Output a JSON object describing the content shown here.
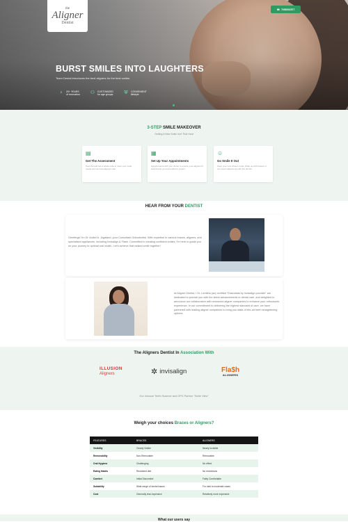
{
  "header": {
    "logo": {
      "the": "the",
      "main": "Aligner",
      "sub": "Dentist"
    },
    "call_button": "7058032577"
  },
  "hero": {
    "title": "BURST SMILES INTO LAUGHTERS",
    "subtitle": "Team Dental introduces the best aligners for the best smiles.",
    "stats": [
      {
        "icon": "lightbulb-icon",
        "line1": "20+ YEARS",
        "line2": "of innovation"
      },
      {
        "icon": "users-icon",
        "line1": "CUSTOMIZED",
        "line2": "for age groups"
      },
      {
        "icon": "shield-icon",
        "line1": "CONVENIENT",
        "line2": "lifestyle"
      }
    ]
  },
  "steps": {
    "title_accent": "3-STEP",
    "title_rest": " SMILE MAKEOVER",
    "subtitle": "Getting A New Smile Isn't That Hard",
    "cards": [
      {
        "icon": "clipboard-icon",
        "title": "Get The Assessment",
        "text": "Team Dental has a whole suite to meet your smile needs and we treat aligners well."
      },
      {
        "icon": "calendar-icon",
        "title": "Set Up Your Appointments",
        "text": "Appointments with your doctor to ensure your aligners fit well and let you know what to expect."
      },
      {
        "icon": "smile-icon",
        "title": "Go Smile It Out",
        "text": "Keep your new chosen smile. Wrap up with braces or our expert alignments with the dentist."
      }
    ]
  },
  "hear": {
    "title_plain": "HEAR FROM YOUR ",
    "title_accent": "DENTIST",
    "doctor1_text": "Greetings! I'm Dr. Anikel A. Jugaland, your Consultant Orthodontist. With expertise in various braces, aligners, and specialised appliances, including Invisalign & Flash. Committed to creating confident smiles, I'm here to guide you on your journey to optimal oral health. Let's achieve that radiant smile together!",
    "doctor2_text": "At Aligner Dentist, I Dr. Lemitha (an) certified \"Essentials by Invisalign provider\" am dedicated to provide you with the latest advancements in dental care, and delighted to announce our collaboration with renowned aligner companies to enhance your orthodontic experience. In our commitment to delivering the highest standard of care, we have partnered with leading aligner companies to bring you state-of-the-art teeth straightening options."
  },
  "association": {
    "title_plain": "The Aligners Dentist In ",
    "title_accent": "Association With",
    "brands": {
      "illusion_l1": "ILLUSION",
      "illusion_l2": "Aligners",
      "invisalign": "invisalign",
      "flash_l1": "Fla$h",
      "flash_l2": "ALIGNERS"
    },
    "note": "Our Inhouse Teeth Scanner and OPG Partner \"Smile View\""
  },
  "compare": {
    "title_plain": "Weigh your choices ",
    "title_accent": "Braces or Aligners?",
    "headers": [
      "FEATURES",
      "BRACES",
      "ALIGNERS"
    ],
    "rows": [
      [
        "Visibility",
        "Clearly Visible",
        "Nearly Invisible"
      ],
      [
        "Removability",
        "Non-Removable",
        "Removable"
      ],
      [
        "Oral Hygiene",
        "Challenging",
        "No effect"
      ],
      [
        "Eating Habits",
        "Restricted diet",
        "No restrictions"
      ],
      [
        "Comfort",
        "Initial Discomfort",
        "Fairly Comfortable"
      ],
      [
        "Suitability",
        "Wide range of dental issues",
        "For mild to moderate cases"
      ],
      [
        "Cost",
        "Generally less expensive",
        "Relatively more expensive"
      ]
    ]
  },
  "footer_peek": "What our users say"
}
